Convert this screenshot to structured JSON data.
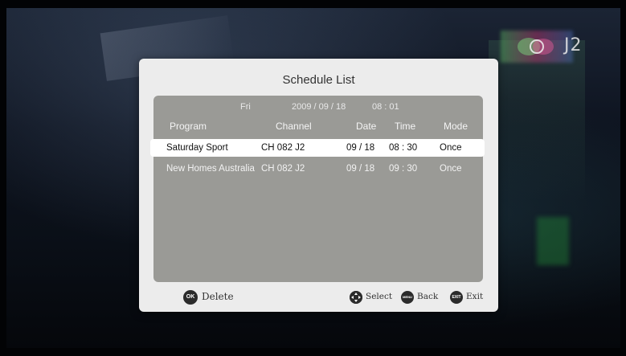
{
  "dialog": {
    "title": "Schedule List"
  },
  "clock": {
    "day": "Fri",
    "date": "2009 / 09 / 18",
    "time": "08 : 01"
  },
  "columns": {
    "program": "Program",
    "channel": "Channel",
    "date": "Date",
    "time": "Time",
    "mode": "Mode"
  },
  "schedule": [
    {
      "program": "Saturday Sport",
      "channel": "CH 082 J2",
      "date": "09 / 18",
      "time": "08 : 30",
      "mode": "Once",
      "selected": true
    },
    {
      "program": "New Homes Australia",
      "channel": "CH 082 J2",
      "date": "09 / 18",
      "time": "09 : 30",
      "mode": "Once",
      "selected": false
    }
  ],
  "footer": {
    "ok_icon": "OK",
    "delete_label": "Delete",
    "select_label": "Select",
    "menu_icon": "MENU",
    "back_label": "Back",
    "exit_icon": "EXIT",
    "exit_label": "Exit"
  },
  "watermark": {
    "text": "J2"
  },
  "icons": {
    "ok": "ok-button-icon",
    "navigate": "dpad-navigate-icon",
    "menu": "menu-button-icon",
    "exit": "exit-button-icon"
  },
  "colors": {
    "dialog_bg": "#ececec",
    "panel_bg": "#9a9a96",
    "selected_row_bg": "#ffffff",
    "button_icon": "#2b2b2b"
  }
}
